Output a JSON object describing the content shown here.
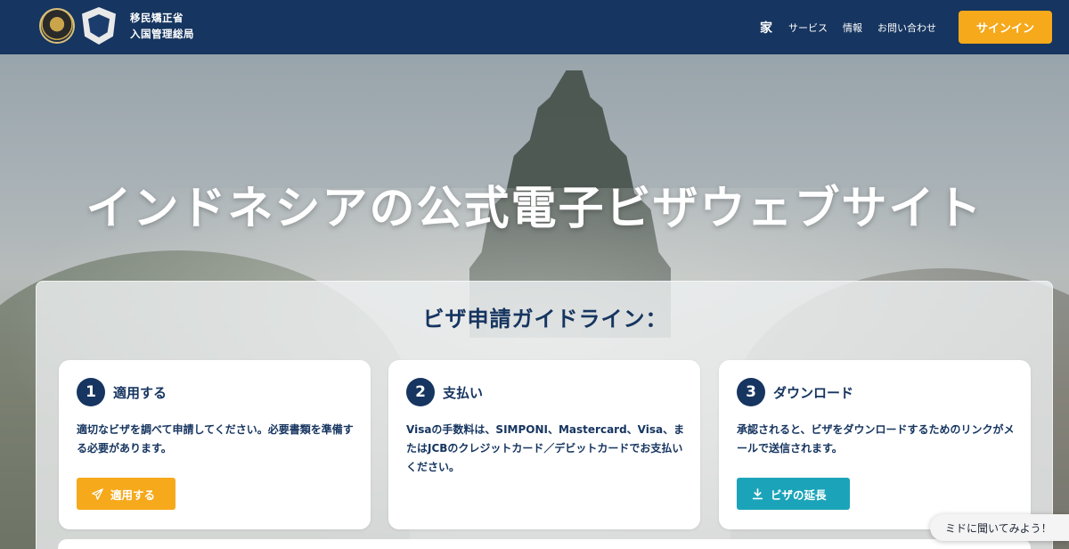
{
  "header": {
    "org_line1": "移民矯正省",
    "org_line2": "入国管理総局",
    "nav": {
      "home": "家",
      "services": "サービス",
      "info": "情報",
      "contact": "お問い合わせ"
    },
    "signin_label": "サインイン"
  },
  "hero": {
    "title": "インドネシアの公式電子ビザウェブサイト"
  },
  "guidelines": {
    "title": "ビザ申請ガイドライン：",
    "cards": [
      {
        "number": "1",
        "title": "適用する",
        "text": "適切なビザを調べて申請してください。必要書類を準備する必要があります。",
        "button": "適用する",
        "button_icon": "paper-plane-icon"
      },
      {
        "number": "2",
        "title": "支払い",
        "text": "Visaの手数料は、SIMPONI、Mastercard、Visa、またはJCBのクレジットカード／デビットカードでお支払いください。"
      },
      {
        "number": "3",
        "title": "ダウンロード",
        "text": "承認されると、ビザをダウンロードするためのリンクがメールで送信されます。",
        "button": "ビザの延長",
        "button_icon": "download-icon"
      }
    ]
  },
  "chat": {
    "label": "ミドに聞いてみよう！"
  },
  "colors": {
    "navy": "#163560",
    "accent": "#f6a91b",
    "teal": "#1ba4b9"
  }
}
